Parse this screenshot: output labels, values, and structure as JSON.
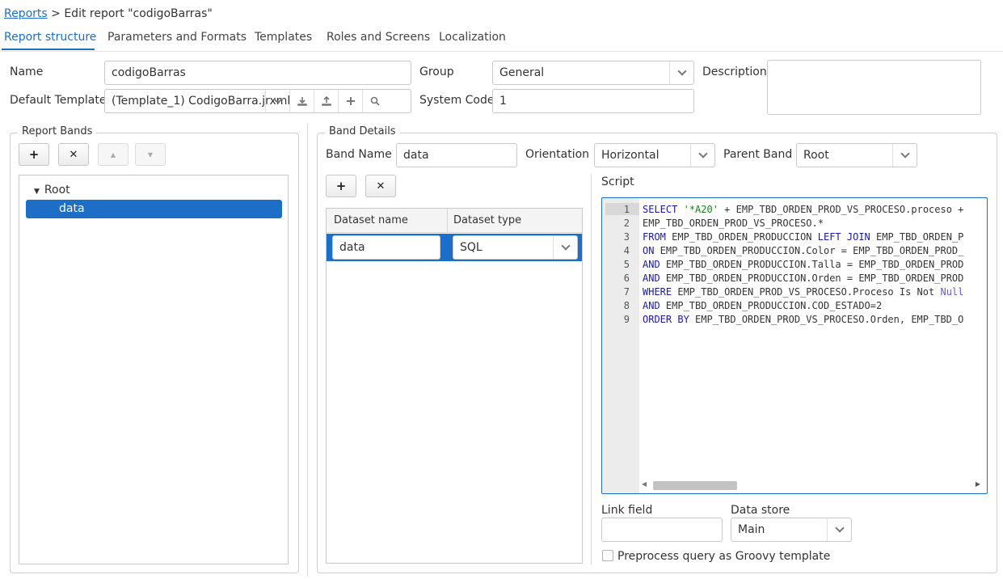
{
  "breadcrumb": {
    "link": "Reports",
    "rest": " > Edit report \"codigoBarras\""
  },
  "tabs": [
    {
      "label": "Report structure"
    },
    {
      "label": "Parameters and Formats"
    },
    {
      "label": "Templates"
    },
    {
      "label": "Roles and Screens"
    },
    {
      "label": "Localization"
    }
  ],
  "form": {
    "name_label": "Name",
    "name_value": "codigoBarras",
    "group_label": "Group",
    "group_value": "General",
    "description_label": "Description",
    "template_label": "Default Template",
    "template_value": "(Template_1) CodigoBarra.jrxml",
    "system_code_label": "System Code",
    "system_code_value": "1"
  },
  "report_bands": {
    "legend": "Report Bands",
    "buttons": {
      "add": "+",
      "remove": "✕",
      "up": "▲",
      "down": "▼"
    },
    "tree": {
      "root": "Root",
      "selected": "data"
    }
  },
  "band_details": {
    "legend": "Band Details",
    "band_name_label": "Band Name",
    "band_name_value": "data",
    "orientation_label": "Orientation",
    "orientation_value": "Horizontal",
    "parent_band_label": "Parent Band",
    "parent_band_value": "Root",
    "dataset_buttons": {
      "add": "+",
      "remove": "✕"
    },
    "dataset_columns": [
      "Dataset name",
      "Dataset type"
    ],
    "dataset_row": {
      "name": "data",
      "type": "SQL"
    },
    "script_label": "Script",
    "script_line_numbers": [
      "1",
      "2",
      "3",
      "4",
      "5",
      "6",
      "7",
      "8",
      "9"
    ],
    "link_field_label": "Link field",
    "link_field_value": "",
    "data_store_label": "Data store",
    "data_store_value": "Main",
    "preprocess_label": "Preprocess query as Groovy template"
  },
  "script": {
    "l1_kw": "SELECT",
    "l1_str": "'*A20'",
    "l1_rest": " + EMP_TBD_ORDEN_PROD_VS_PROCESO.proceso +",
    "l2": "EMP_TBD_ORDEN_PROD_VS_PROCESO.*",
    "l3_kw1": "FROM",
    "l3_mid": " EMP_TBD_ORDEN_PRODUCCION ",
    "l3_kw2": "LEFT JOIN",
    "l3_rest": " EMP_TBD_ORDEN_P",
    "l4_kw": "ON",
    "l4_rest": " EMP_TBD_ORDEN_PRODUCCION.Color = EMP_TBD_ORDEN_PROD_",
    "l5_kw": "AND",
    "l5_rest": " EMP_TBD_ORDEN_PRODUCCION.Talla = EMP_TBD_ORDEN_PROD",
    "l6_kw": "AND",
    "l6_rest": " EMP_TBD_ORDEN_PRODUCCION.Orden = EMP_TBD_ORDEN_PROD",
    "l7_kw": "WHERE",
    "l7_rest": " EMP_TBD_ORDEN_PROD_VS_PROCESO.Proceso Is Not ",
    "l7_null": "Null",
    "l8_kw": "AND",
    "l8_rest": " EMP_TBD_ORDEN_PRODUCCION.COD_ESTADO=2",
    "l9_kw": "ORDER BY",
    "l9_rest": " EMP_TBD_ORDEN_PROD_VS_PROCESO.Orden, EMP_TBD_O"
  },
  "colors": {
    "accent": "#1d6ec7",
    "keyword": "#1a1aa6",
    "string": "#1a7f1a"
  },
  "icons": [
    "download-icon",
    "upload-icon",
    "plus-icon",
    "search-icon",
    "chevron-down-icon",
    "triangle-down-icon"
  ]
}
